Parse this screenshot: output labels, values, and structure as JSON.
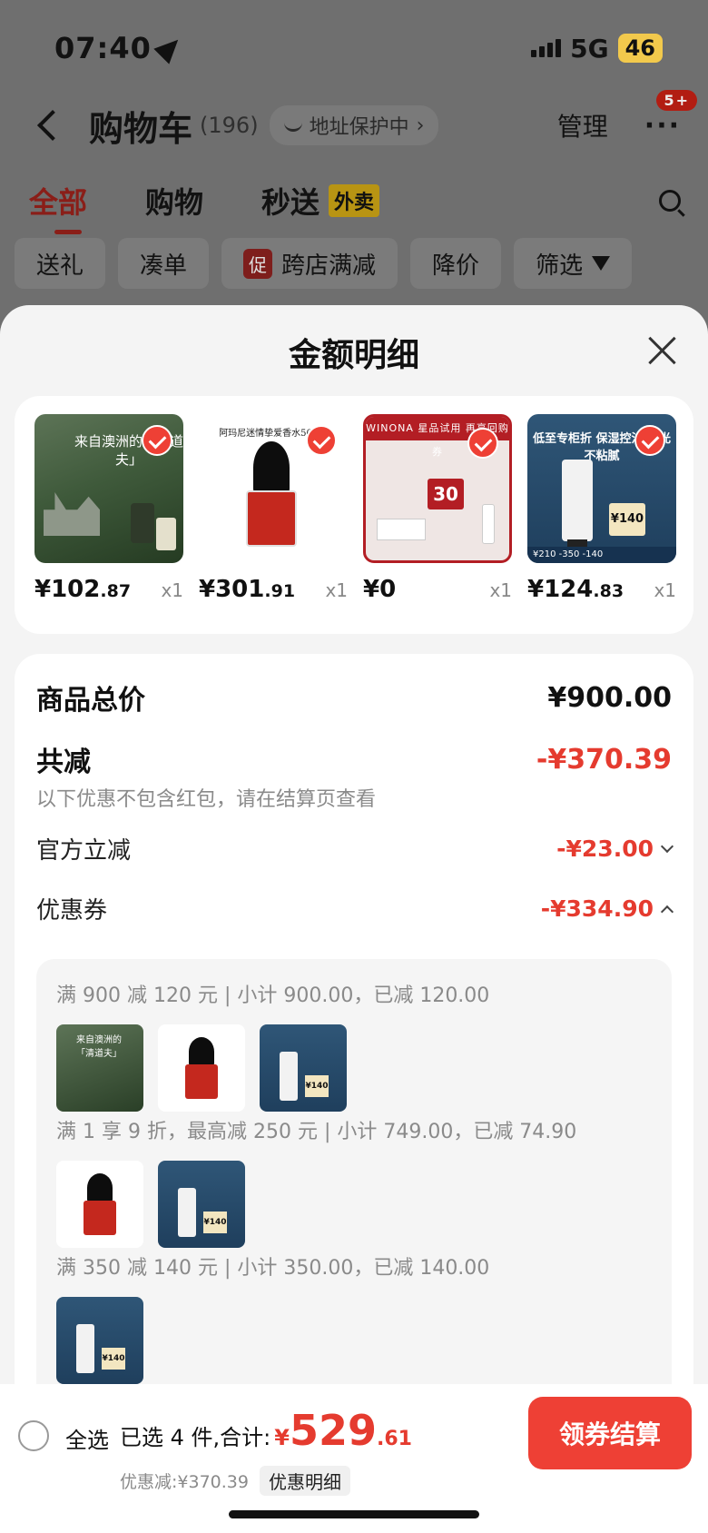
{
  "status": {
    "time": "07:40",
    "network": "5G",
    "battery": "46"
  },
  "header": {
    "title": "购物车",
    "count": "(196)",
    "address_protect": "地址保护中",
    "manage": "管理",
    "more": "···",
    "more_badge": "5+"
  },
  "tabs": [
    {
      "label": "全部"
    },
    {
      "label": "购物"
    },
    {
      "label": "秒送",
      "tag": "外卖"
    }
  ],
  "chips": [
    {
      "label": "送礼"
    },
    {
      "label": "凑单"
    },
    {
      "label": "跨店满减",
      "mark": "促"
    },
    {
      "label": "降价"
    },
    {
      "label": "筛选"
    }
  ],
  "sheet": {
    "title": "金额明细",
    "products": [
      {
        "name": "来自澳洲的「清道夫」",
        "price_int": "¥102",
        "price_dec": ".87",
        "qty": "x1"
      },
      {
        "name": "阿玛尼迷情挚爱香水50ML",
        "price_int": "¥301",
        "price_dec": ".91",
        "qty": "x1"
      },
      {
        "name": "WINONA 星品试用 再享回购券",
        "badge": "30",
        "price_int": "¥0",
        "price_dec": "",
        "qty": "x1"
      },
      {
        "name": "低至专柜折 保湿控油 哑光不粘腻",
        "badge": "¥140",
        "strip": "¥210 -350 -140",
        "price_int": "¥124",
        "price_dec": ".83",
        "qty": "x1"
      }
    ],
    "summary": {
      "goods_total_label": "商品总价",
      "goods_total_value": "¥900.00",
      "reduce_label": "共减",
      "reduce_value": "-¥370.39",
      "reduce_note": "以下优惠不包含红包，请在结算页查看",
      "official_label": "官方立减",
      "official_value": "-¥23.00",
      "coupon_label": "优惠券",
      "coupon_value": "-¥334.90"
    },
    "coupon_groups": [
      {
        "text": "满 900 减 120 元 | 小计 900.00，已减 120.00",
        "items": [
          "forest",
          "perfume",
          "lab"
        ]
      },
      {
        "text": "满 1 享 9 折，最高减 250 元 | 小计 749.00，已减 74.90",
        "items": [
          "perfume",
          "lab"
        ]
      },
      {
        "text": "满 350 减 140 元 | 小计 350.00，已减 140.00",
        "items": [
          "lab"
        ]
      }
    ]
  },
  "bottom": {
    "select_all": "全选",
    "selected_text": "已选 4 件,合计:",
    "currency": "¥",
    "total_int": "529",
    "total_dec": ".61",
    "discount": "优惠减:¥370.39",
    "detail": "优惠明细",
    "checkout": "领券结算"
  },
  "colors": {
    "accent": "#ee4035",
    "price_red": "#e53b2f"
  }
}
